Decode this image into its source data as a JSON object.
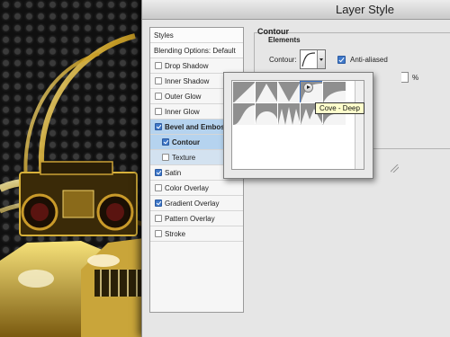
{
  "dialog": {
    "title": "Layer Style"
  },
  "stylelist": {
    "header": "Styles",
    "blending": "Blending Options: Default",
    "items": [
      {
        "label": "Drop Shadow",
        "checked": false,
        "bold": false,
        "selected": false,
        "sub": false
      },
      {
        "label": "Inner Shadow",
        "checked": false,
        "bold": false,
        "selected": false,
        "sub": false
      },
      {
        "label": "Outer Glow",
        "checked": false,
        "bold": false,
        "selected": false,
        "sub": false
      },
      {
        "label": "Inner Glow",
        "checked": false,
        "bold": false,
        "selected": false,
        "sub": false
      },
      {
        "label": "Bevel and Emboss",
        "checked": true,
        "bold": true,
        "selected": true,
        "sub": false
      },
      {
        "label": "Contour",
        "checked": true,
        "bold": true,
        "selected": true,
        "sub": true
      },
      {
        "label": "Texture",
        "checked": false,
        "bold": false,
        "selected": false,
        "sub": true
      },
      {
        "label": "Satin",
        "checked": true,
        "bold": false,
        "selected": false,
        "sub": false
      },
      {
        "label": "Color Overlay",
        "checked": false,
        "bold": false,
        "selected": false,
        "sub": false
      },
      {
        "label": "Gradient Overlay",
        "checked": true,
        "bold": false,
        "selected": false,
        "sub": false
      },
      {
        "label": "Pattern Overlay",
        "checked": false,
        "bold": false,
        "selected": false,
        "sub": false
      },
      {
        "label": "Stroke",
        "checked": false,
        "bold": false,
        "selected": false,
        "sub": false
      }
    ]
  },
  "panel": {
    "group_title": "Contour",
    "subgroup_title": "Elements",
    "contour_label": "Contour:",
    "antialiased_label": "Anti-aliased",
    "antialiased": true,
    "range_unit": "%"
  },
  "popup": {
    "tooltip": "Cove - Deep",
    "menu_icon": "triangle-right-icon",
    "resize_icon": "resize-grip-icon"
  },
  "colors": {
    "dialog_bg": "#e6e6e6",
    "selection": "#b5d3ef",
    "checkbox_on": "#3f78c9",
    "tooltip_bg": "#ffffcc"
  }
}
